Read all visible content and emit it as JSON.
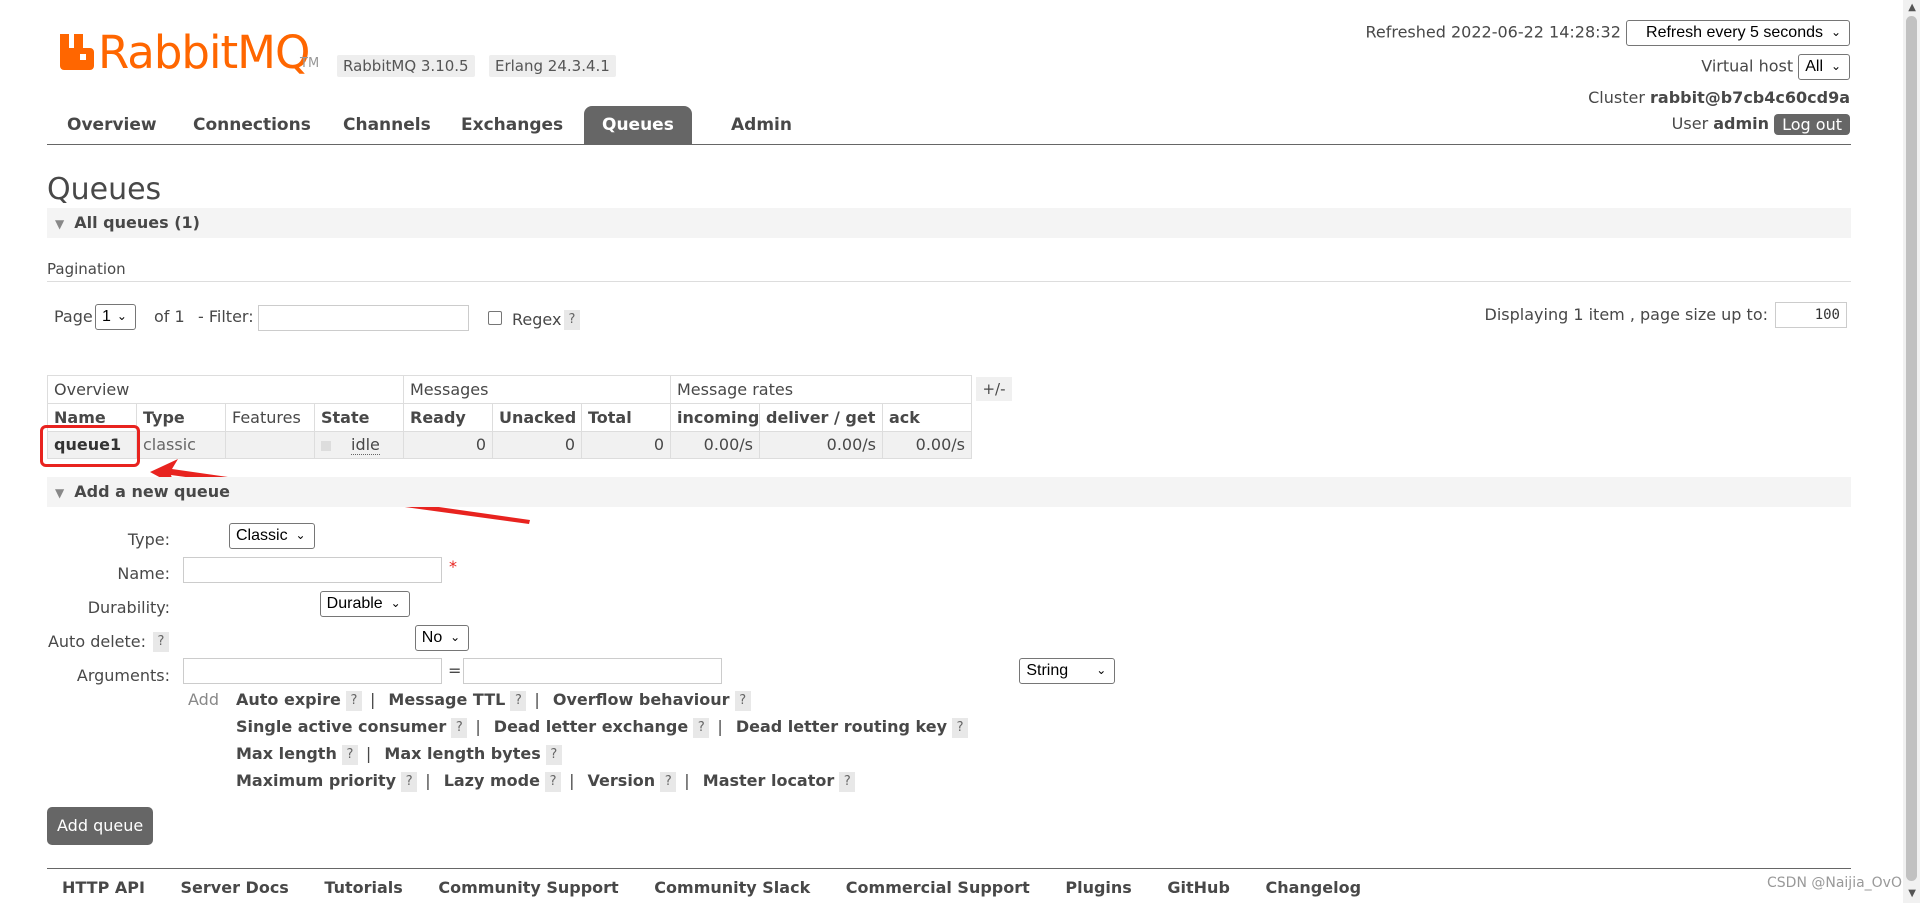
{
  "header": {
    "logo_text": "RabbitMQ",
    "logo_tm": "TM",
    "rabbitmq_version": "RabbitMQ 3.10.5",
    "erlang_version": "Erlang 24.3.4.1",
    "refreshed": "Refreshed 2022-06-22 14:28:32",
    "refresh_select": "Refresh every 5 seconds",
    "virtual_host_label": "Virtual host",
    "virtual_host_value": "All",
    "cluster_label": "Cluster",
    "cluster_value": "rabbit@b7cb4c60cd9a",
    "user_label": "User",
    "user_value": "admin",
    "logout": "Log out",
    "brand_color": "#ff6600"
  },
  "nav": {
    "tabs": [
      {
        "label": "Overview",
        "active": false
      },
      {
        "label": "Connections",
        "active": false
      },
      {
        "label": "Channels",
        "active": false
      },
      {
        "label": "Exchanges",
        "active": false
      },
      {
        "label": "Queues",
        "active": true
      },
      {
        "label": "Admin",
        "active": false
      }
    ]
  },
  "page": {
    "title": "Queues",
    "all_queues": "All queues (1)",
    "pagination_label": "Pagination",
    "page_label": "Page",
    "page_value": "1",
    "of_label": "of 1",
    "filter_label": "- Filter:",
    "filter_value": "",
    "regex_label": "Regex",
    "help": "?",
    "displaying": "Displaying 1 item , page size up to:",
    "page_size": "100"
  },
  "table": {
    "groups": [
      "Overview",
      "Messages",
      "Message rates"
    ],
    "plusminus": "+/-",
    "columns": [
      "Name",
      "Type",
      "Features",
      "State",
      "Ready",
      "Unacked",
      "Total",
      "incoming",
      "deliver / get",
      "ack"
    ],
    "rows": [
      {
        "name": "queue1",
        "type": "classic",
        "features": "",
        "state": "idle",
        "ready": "0",
        "unacked": "0",
        "total": "0",
        "incoming": "0.00/s",
        "deliver_get": "0.00/s",
        "ack": "0.00/s"
      }
    ]
  },
  "add_queue": {
    "section": "Add a new queue",
    "type_label": "Type:",
    "type_value": "Classic",
    "name_label": "Name:",
    "name_value": "",
    "required_mark": "*",
    "durability_label": "Durability:",
    "durability_value": "Durable",
    "auto_delete_label": "Auto delete:",
    "auto_delete_value": "No",
    "arguments_label": "Arguments:",
    "equals": "=",
    "arg_type_value": "String",
    "add_link": "Add",
    "arg_rows": [
      [
        "Auto expire",
        "Message TTL",
        "Overflow behaviour"
      ],
      [
        "Single active consumer",
        "Dead letter exchange",
        "Dead letter routing key"
      ],
      [
        "Max length",
        "Max length bytes"
      ],
      [
        "Maximum priority",
        "Lazy mode",
        "Version",
        "Master locator"
      ]
    ],
    "submit": "Add queue"
  },
  "footer": {
    "links": [
      "HTTP API",
      "Server Docs",
      "Tutorials",
      "Community Support",
      "Community Slack",
      "Commercial Support",
      "Plugins",
      "GitHub",
      "Changelog"
    ],
    "watermark": "CSDN @Naijia_OvO"
  },
  "annotation": {
    "color": "#e8231f"
  }
}
